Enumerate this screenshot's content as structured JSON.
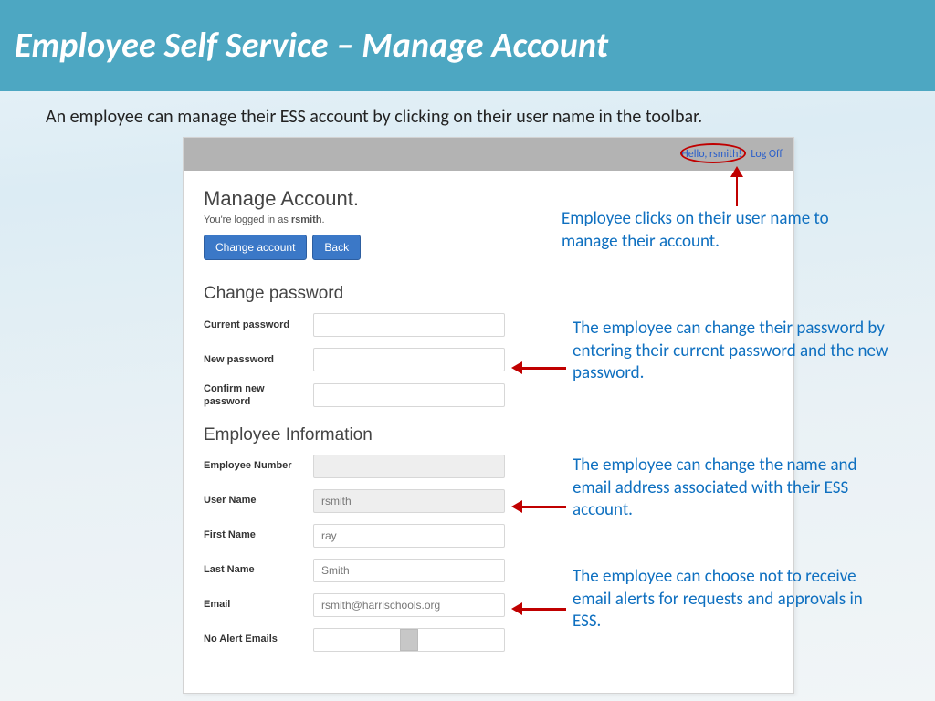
{
  "slide": {
    "title": "Employee Self Service – Manage Account",
    "intro": "An employee can manage their ESS account by clicking on their user name in the toolbar."
  },
  "app": {
    "topbar": {
      "hello": "Hello, rsmith!",
      "logoff": "Log Off"
    },
    "manage_title": "Manage Account.",
    "logged_in_prefix": "You're logged in as ",
    "logged_in_user": "rsmith",
    "logged_in_suffix": ".",
    "buttons": {
      "change_account": "Change account",
      "back": "Back"
    },
    "section_password": "Change password",
    "fields_password": {
      "current": "Current password",
      "new": "New password",
      "confirm": "Confirm new password"
    },
    "section_info": "Employee Information",
    "fields_info": {
      "emp_no": {
        "label": "Employee Number",
        "value": ""
      },
      "user_name": {
        "label": "User Name",
        "value": "rsmith"
      },
      "first_name": {
        "label": "First Name",
        "value": "ray"
      },
      "last_name": {
        "label": "Last Name",
        "value": "Smith"
      },
      "email": {
        "label": "Email",
        "value": "rsmith@harrischools.org"
      },
      "no_alert": {
        "label": "No Alert Emails"
      }
    }
  },
  "callouts": {
    "c1": "Employee clicks on their user name to manage their account.",
    "c2": "The employee can change their password by entering their current password and the new password.",
    "c3": "The employee can change the name and email address associated with their ESS account.",
    "c4": "The employee can choose not to receive email alerts for requests and approvals in ESS."
  }
}
